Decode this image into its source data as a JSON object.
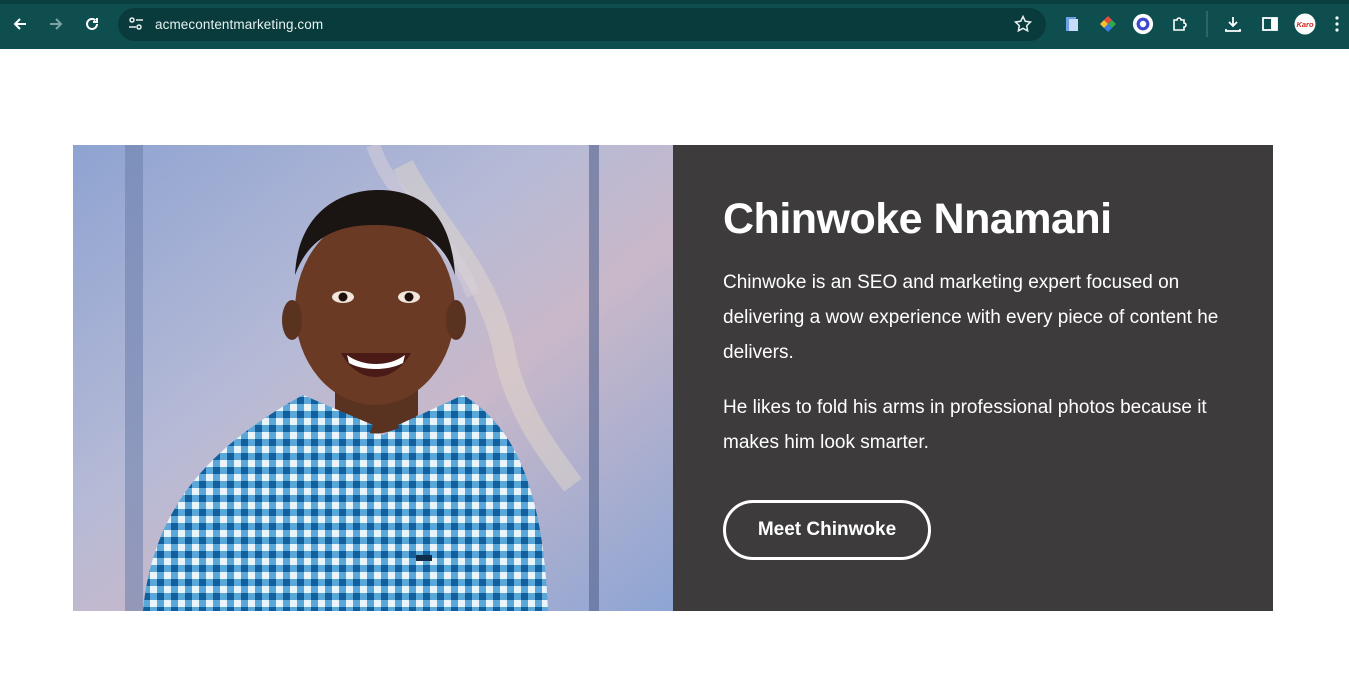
{
  "browser": {
    "url": "acmecontentmarketing.com",
    "toolbar_color": "#0f4e4f",
    "icons": [
      "back-arrow-icon",
      "forward-arrow-icon",
      "reload-icon",
      "site-settings-icon",
      "bookmark-star-icon",
      "extension-docs-icon",
      "extension-color-icon",
      "extension-circle-icon",
      "extensions-puzzle-icon",
      "download-icon",
      "side-panel-icon",
      "profile-avatar-icon",
      "menu-dots-icon"
    ],
    "profile_label": "Karo"
  },
  "profile": {
    "name": "Chinwoke Nnamani",
    "bio_1": "Chinwoke is an SEO and marketing expert focused on delivering a wow experience with every piece of content he delivers.",
    "bio_2": "He likes to fold his arms in professional photos because it makes him look smarter.",
    "cta_label": "Meet Chinwoke",
    "panel_color": "#3d3b3c"
  }
}
